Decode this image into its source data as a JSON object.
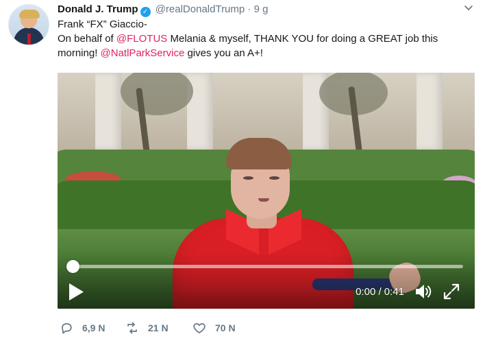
{
  "tweet": {
    "author_name": "Donald J. Trump",
    "verified_mark": "✓",
    "author_handle": "@realDonaldTrump",
    "separator": "·",
    "timestamp": "9 g",
    "text_line1": "Frank “FX” Giaccio-",
    "text_line2_before": "On behalf of ",
    "mention_flotus": "@FLOTUS",
    "text_line2_after": " Melania & myself, THANK YOU for doing a GREAT job this",
    "text_line3_before": "morning! ",
    "mention_natlpark": "@NatlParkService",
    "text_line3_after": " gives you an A+!"
  },
  "video": {
    "time": "0:00 / 0:41",
    "progress": 0.0
  },
  "actions": {
    "reply_count": "6,9 N",
    "retweet_count": "21 N",
    "like_count": "70 N"
  },
  "icons": {
    "caret": "chevron-down-icon",
    "verified": "verified-badge-icon",
    "play": "play-icon",
    "volume": "volume-icon",
    "fullscreen": "fullscreen-icon",
    "reply": "reply-icon",
    "retweet": "retweet-icon",
    "like": "heart-icon"
  },
  "colors": {
    "mention": "#e0245e",
    "muted": "#657786",
    "verified": "#1da1f2"
  }
}
